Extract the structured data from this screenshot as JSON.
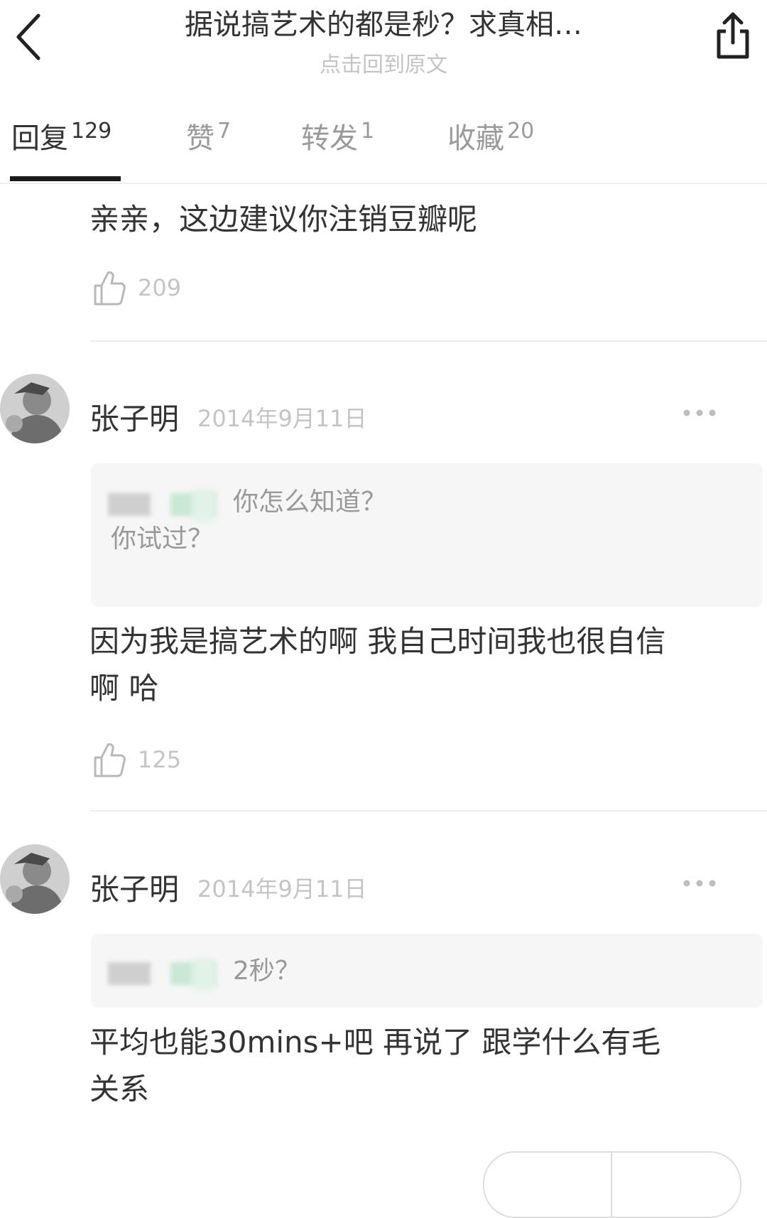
{
  "header": {
    "title": "据说搞艺术的都是秒？求真相…",
    "subtitle": "点击回到原文",
    "back_icon": "chevron-left-icon",
    "share_icon": "share-icon"
  },
  "tabs": [
    {
      "label": "回复",
      "count": "129",
      "active": true
    },
    {
      "label": "赞",
      "count": "7",
      "active": false
    },
    {
      "label": "转发",
      "count": "1",
      "active": false
    },
    {
      "label": "收藏",
      "count": "20",
      "active": false
    }
  ],
  "comments": [
    {
      "text": "亲亲，这边建议你注销豆瓣呢",
      "likes": "209"
    },
    {
      "author": "张子明",
      "date": "2014年9月11日",
      "quote": "你怎么知道？",
      "quote_line2": "你试过？",
      "text_line1": "因为我是搞艺术的啊 我自己时间我也很自信",
      "text_line2": "啊 哈",
      "likes": "125"
    },
    {
      "author": "张子明",
      "date": "2014年9月11日",
      "quote": "2秒？",
      "text_line1": "平均也能30mins+吧 再说了 跟学什么有毛",
      "text_line2": "关系"
    }
  ],
  "colors": {
    "text": "#333333",
    "muted": "#c4c4c4",
    "tab_active_underline": "#1a1a1a",
    "quote_bg": "#f6f6f6"
  }
}
